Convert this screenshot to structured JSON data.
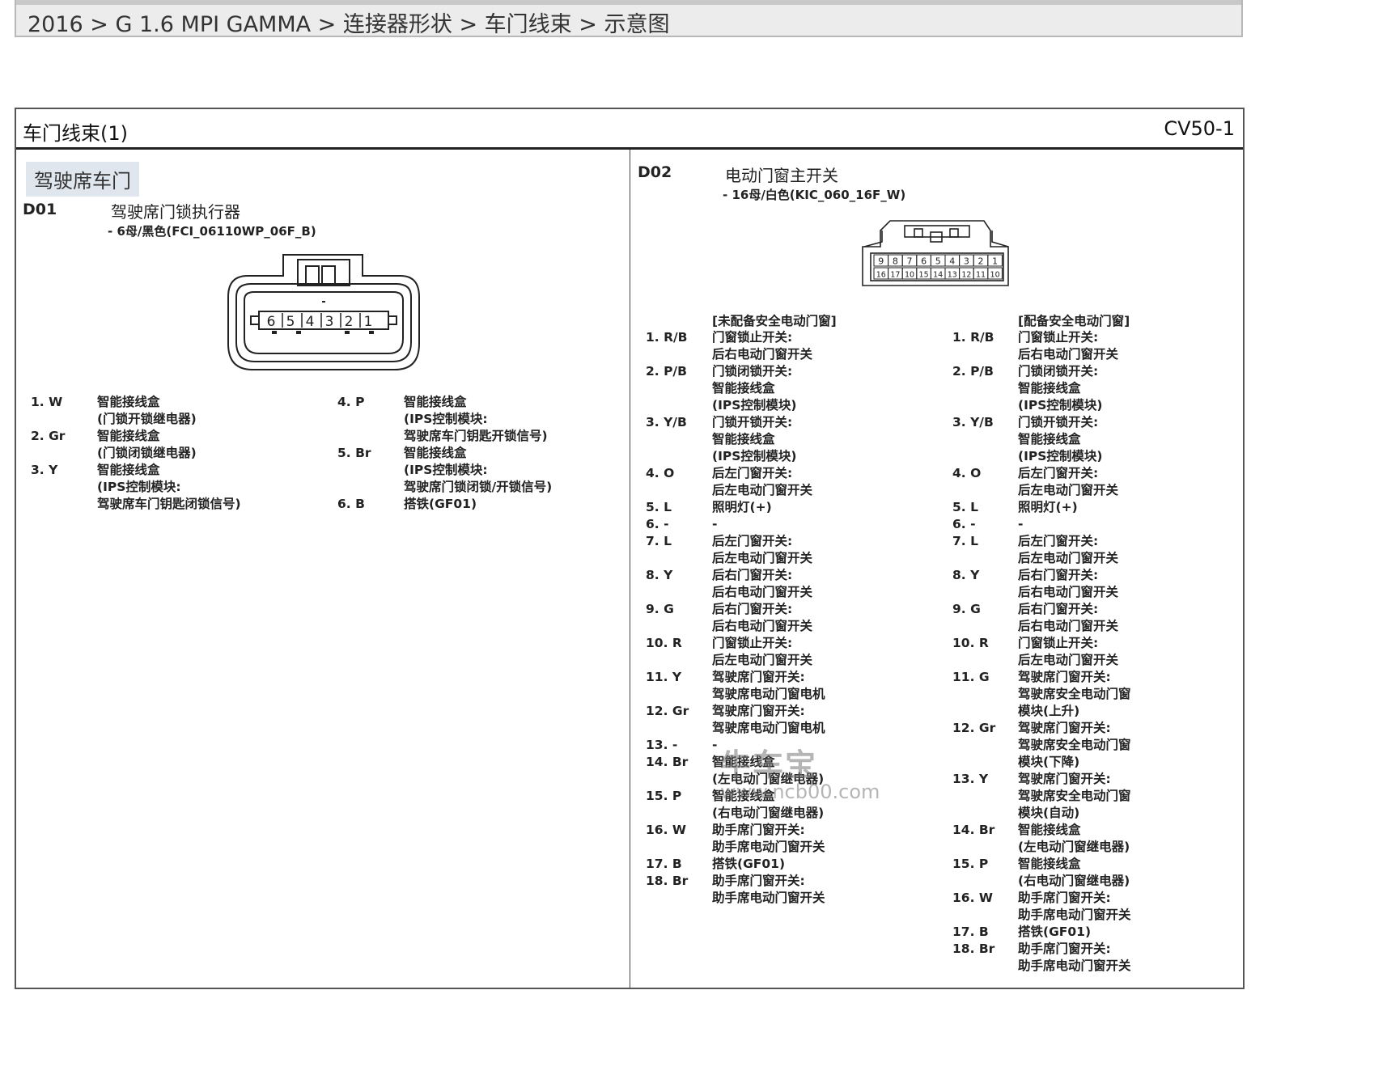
{
  "breadcrumb": "2016 > G 1.6 MPI GAMMA > 连接器形状 > 车门线束 > 示意图",
  "header": {
    "title": "车门线束(1)",
    "code": "CV50-1"
  },
  "section_tab": "驾驶席车门",
  "d01": {
    "id": "D01",
    "name": "驾驶席门锁执行器",
    "spec": "- 6母/黑色(FCI_06110WP_06F_B)",
    "pin_labels": [
      "6",
      "5",
      "4",
      "3",
      "2",
      "1"
    ],
    "pins": [
      {
        "pin": "1. W",
        "desc": "智能接线盒\n(门锁开锁继电器)"
      },
      {
        "pin": "2. Gr",
        "desc": "智能接线盒\n(门锁闭锁继电器)"
      },
      {
        "pin": "3. Y",
        "desc": "智能接线盒\n(IPS控制模块:\n驾驶席车门钥匙闭锁信号)"
      },
      {
        "pin": "4. P",
        "desc": "智能接线盒\n(IPS控制模块:\n驾驶席车门钥匙开锁信号)"
      },
      {
        "pin": "5. Br",
        "desc": "智能接线盒\n(IPS控制模块:\n驾驶席门锁闭锁/开锁信号)"
      },
      {
        "pin": "6. B",
        "desc": "搭铁(GF01)"
      }
    ]
  },
  "d02": {
    "id": "D02",
    "name": "电动门窗主开关",
    "spec": "- 16母/白色(KIC_060_16F_W)",
    "top_row": [
      "9",
      "8",
      "7",
      "6",
      "5",
      "4",
      "3",
      "2",
      "1"
    ],
    "bottom_row": [
      "16",
      "17",
      "10",
      "15",
      "14",
      "13",
      "12",
      "11",
      "10"
    ],
    "left_head": "[未配备安全电动门窗]",
    "right_head": "[配备安全电动门窗]",
    "left": [
      {
        "pin": "1. R/B",
        "desc": "门窗锁止开关:\n后右电动门窗开关"
      },
      {
        "pin": "2. P/B",
        "desc": "门锁闭锁开关:\n智能接线盒\n(IPS控制模块)"
      },
      {
        "pin": "3. Y/B",
        "desc": "门锁开锁开关:\n智能接线盒\n(IPS控制模块)"
      },
      {
        "pin": "4. O",
        "desc": "后左门窗开关:\n后左电动门窗开关"
      },
      {
        "pin": "5. L",
        "desc": "照明灯(+)"
      },
      {
        "pin": "6. -",
        "desc": "-"
      },
      {
        "pin": "7. L",
        "desc": "后左门窗开关:\n后左电动门窗开关"
      },
      {
        "pin": "8. Y",
        "desc": "后右门窗开关:\n后右电动门窗开关"
      },
      {
        "pin": "9. G",
        "desc": "后右门窗开关:\n后右电动门窗开关"
      },
      {
        "pin": "10. R",
        "desc": "门窗锁止开关:\n后左电动门窗开关"
      },
      {
        "pin": "11. Y",
        "desc": "驾驶席门窗开关:\n驾驶席电动门窗电机"
      },
      {
        "pin": "12. Gr",
        "desc": "驾驶席门窗开关:\n驾驶席电动门窗电机"
      },
      {
        "pin": "13. -",
        "desc": "-"
      },
      {
        "pin": "14. Br",
        "desc": "智能接线盒\n(左电动门窗继电器)"
      },
      {
        "pin": "15. P",
        "desc": "智能接线盒\n(右电动门窗继电器)"
      },
      {
        "pin": "16. W",
        "desc": "助手席门窗开关:\n助手席电动门窗开关"
      },
      {
        "pin": "17. B",
        "desc": "搭铁(GF01)"
      },
      {
        "pin": "18. Br",
        "desc": "助手席门窗开关:\n助手席电动门窗开关"
      }
    ],
    "right": [
      {
        "pin": "1. R/B",
        "desc": "门窗锁止开关:\n后右电动门窗开关"
      },
      {
        "pin": "2. P/B",
        "desc": "门锁闭锁开关:\n智能接线盒\n(IPS控制模块)"
      },
      {
        "pin": "3. Y/B",
        "desc": "门锁开锁开关:\n智能接线盒\n(IPS控制模块)"
      },
      {
        "pin": "4. O",
        "desc": "后左门窗开关:\n后左电动门窗开关"
      },
      {
        "pin": "5. L",
        "desc": "照明灯(+)"
      },
      {
        "pin": "6. -",
        "desc": "-"
      },
      {
        "pin": "7. L",
        "desc": "后左门窗开关:\n后左电动门窗开关"
      },
      {
        "pin": "8. Y",
        "desc": "后右门窗开关:\n后右电动门窗开关"
      },
      {
        "pin": "9. G",
        "desc": "后右门窗开关:\n后右电动门窗开关"
      },
      {
        "pin": "10. R",
        "desc": "门窗锁止开关:\n后左电动门窗开关"
      },
      {
        "pin": "11. G",
        "desc": "驾驶席门窗开关:\n驾驶席安全电动门窗\n模块(上升)"
      },
      {
        "pin": "12. Gr",
        "desc": "驾驶席门窗开关:\n驾驶席安全电动门窗\n模块(下降)"
      },
      {
        "pin": "13. Y",
        "desc": "驾驶席门窗开关:\n驾驶席安全电动门窗\n模块(自动)"
      },
      {
        "pin": "14. Br",
        "desc": "智能接线盒\n(左电动门窗继电器)"
      },
      {
        "pin": "15. P",
        "desc": "智能接线盒\n(右电动门窗继电器)"
      },
      {
        "pin": "16. W",
        "desc": "助手席门窗开关:\n助手席电动门窗开关"
      },
      {
        "pin": "17. B",
        "desc": "搭铁(GF01)"
      },
      {
        "pin": "18. Br",
        "desc": "助手席门窗开关:\n助手席电动门窗开关"
      }
    ]
  },
  "watermark": {
    "line1": "牛车宝",
    "line2": "www.ncb00.com"
  }
}
